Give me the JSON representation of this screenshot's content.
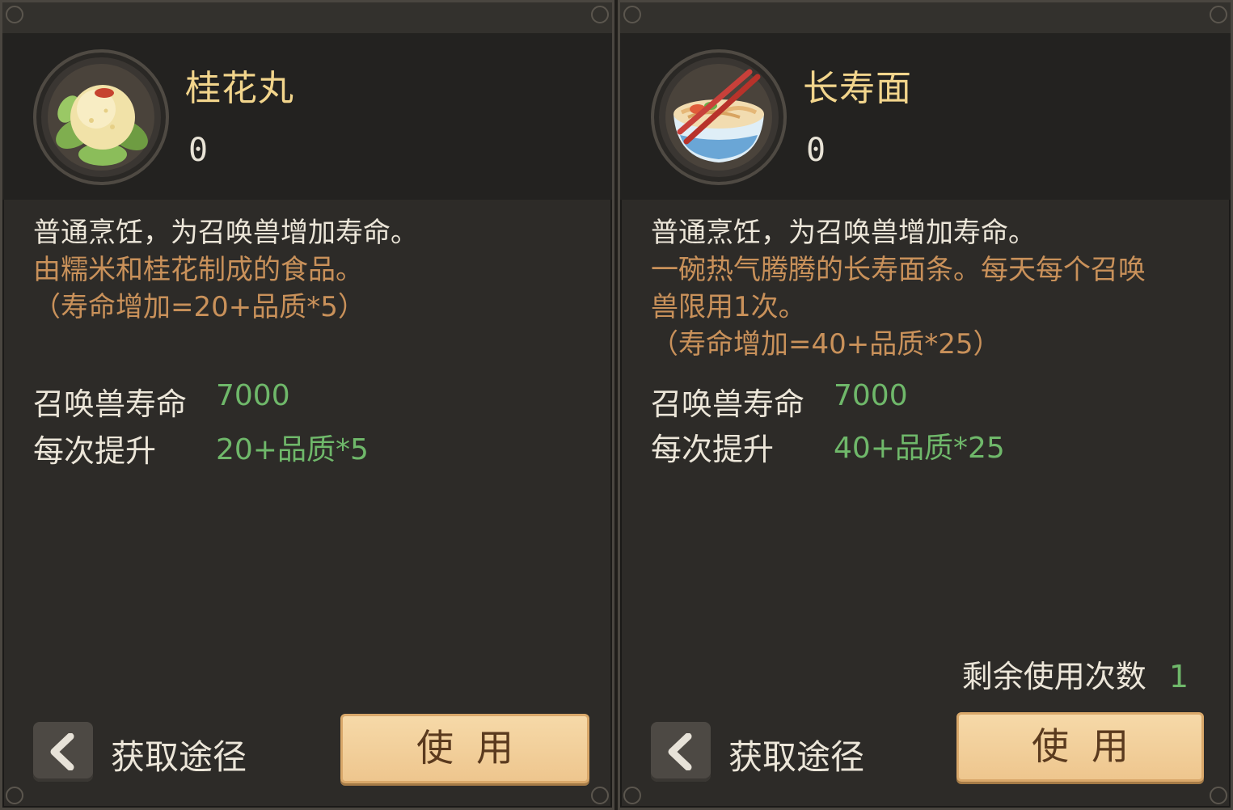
{
  "cards": [
    {
      "name": "桂花丸",
      "count": "0",
      "description": "普通烹饪，为召唤兽增加寿命。",
      "flavor_lines": [
        "由糯米和桂花制成的食品。",
        "（寿命增加=20+品质*5）"
      ],
      "stats": [
        {
          "label": "召唤兽寿命",
          "value": "7000"
        },
        {
          "label": "每次提升",
          "value": "20+品质*5"
        }
      ],
      "source_label": "获取途径",
      "use_label": "使用",
      "icon": "osmanthus-ball-icon"
    },
    {
      "name": "长寿面",
      "count": "0",
      "description": "普通烹饪，为召唤兽增加寿命。",
      "flavor_lines": [
        "一碗热气腾腾的长寿面条。每天每个召唤",
        "兽限用1次。",
        "（寿命增加=40+品质*25）"
      ],
      "stats": [
        {
          "label": "召唤兽寿命",
          "value": "7000"
        },
        {
          "label": "每次提升",
          "value": "40+品质*25"
        }
      ],
      "remaining_label": "剩余使用次数",
      "remaining_value": "1",
      "source_label": "获取途径",
      "use_label": "使用",
      "icon": "longevity-noodles-icon"
    }
  ],
  "colors": {
    "name": "#f2d58c",
    "flavor": "#c9915a",
    "stat_value": "#6fb86a",
    "button": "#f2d09b"
  }
}
